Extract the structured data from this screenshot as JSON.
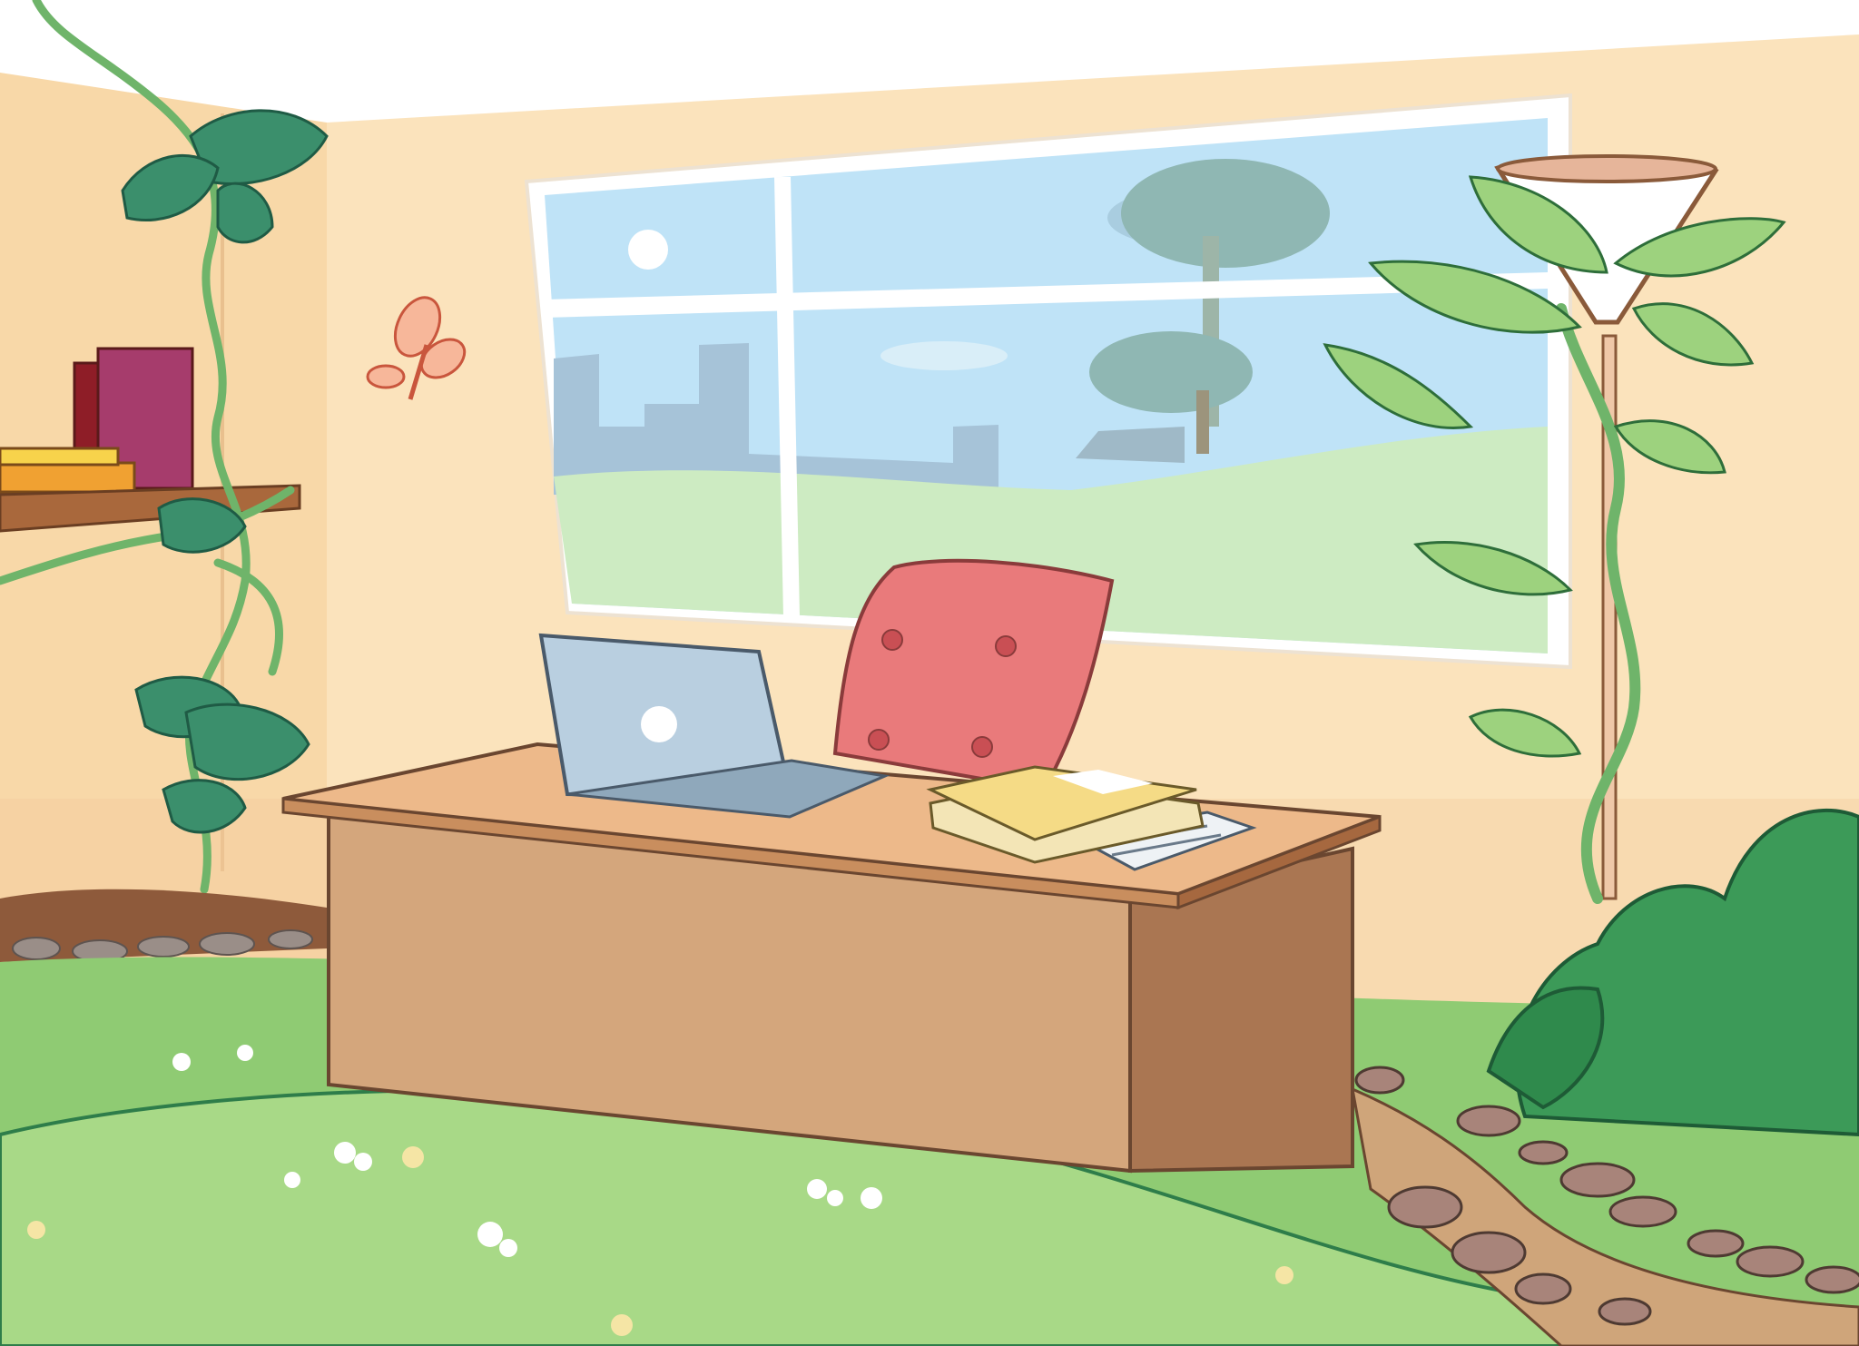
{
  "scene": {
    "palette": {
      "wall": "#FBE3BC",
      "wall_shadow": "#F5CFA0",
      "ceiling": "#FFFFFF",
      "sky": "#BFE3F7",
      "hill_far": "#CDEBC2",
      "grass": "#9ED37D",
      "grass_dark": "#7DBD62",
      "desk_top": "#EDB98A",
      "desk_front": "#D2A67C",
      "desk_side": "#AA7652",
      "chair": "#E97A7B",
      "laptop": "#B9CFE0",
      "book_yellow": "#F5DB86",
      "lamp_shade": "#FFFFFF",
      "lamp_pole": "#EFC8A8",
      "vine": "#6FB46A",
      "leaf_dark": "#3B8F6C",
      "leaf_light": "#9DD27E",
      "bush": "#3C9A58",
      "path": "#CFA57A",
      "stone": "#A8847A",
      "outline": "#6A4630"
    },
    "objects": [
      "wall-shelf-books",
      "climbing-vine",
      "window-landscape",
      "butterfly",
      "desk",
      "laptop",
      "office-chair",
      "stack-of-books",
      "papers",
      "floor-lamp",
      "bean-plant",
      "garden-bush",
      "stone-path",
      "grass-floor"
    ]
  }
}
